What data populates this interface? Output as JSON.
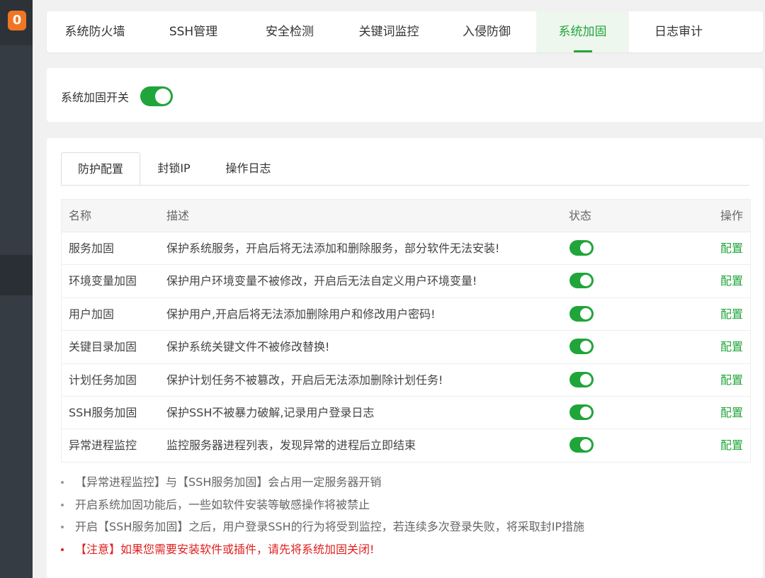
{
  "sidebar": {
    "badge": "0"
  },
  "topnav": {
    "tabs": [
      {
        "label": "系统防火墙"
      },
      {
        "label": "SSH管理"
      },
      {
        "label": "安全检测"
      },
      {
        "label": "关键词监控"
      },
      {
        "label": "入侵防御"
      },
      {
        "label": "系统加固"
      },
      {
        "label": "日志审计"
      }
    ],
    "active_index": 5
  },
  "switch_panel": {
    "label": "系统加固开关",
    "enabled": true
  },
  "subtabs": [
    {
      "label": "防护配置"
    },
    {
      "label": "封锁IP"
    },
    {
      "label": "操作日志"
    }
  ],
  "table": {
    "headers": {
      "name": "名称",
      "desc": "描述",
      "status": "状态",
      "action": "操作"
    },
    "rows": [
      {
        "name": "服务加固",
        "desc": "保护系统服务，开启后将无法添加和删除服务，部分软件无法安装!",
        "enabled": true,
        "action": "配置"
      },
      {
        "name": "环境变量加固",
        "desc": "保护用户环境变量不被修改，开启后无法自定义用户环境变量!",
        "enabled": true,
        "action": "配置"
      },
      {
        "name": "用户加固",
        "desc": "保护用户,开启后将无法添加删除用户和修改用户密码!",
        "enabled": true,
        "action": "配置"
      },
      {
        "name": "关键目录加固",
        "desc": "保护系统关键文件不被修改替换!",
        "enabled": true,
        "action": "配置"
      },
      {
        "name": "计划任务加固",
        "desc": "保护计划任务不被篡改，开启后无法添加删除计划任务!",
        "enabled": true,
        "action": "配置"
      },
      {
        "name": "SSH服务加固",
        "desc": "保护SSH不被暴力破解,记录用户登录日志",
        "enabled": true,
        "action": "配置"
      },
      {
        "name": "异常进程监控",
        "desc": "监控服务器进程列表，发现异常的进程后立即结束",
        "enabled": true,
        "action": "配置"
      }
    ]
  },
  "notes": [
    "【异常进程监控】与【SSH服务加固】会占用一定服务器开销",
    "开启系统加固功能后，一些如软件安装等敏感操作将被禁止",
    "开启【SSH服务加固】之后，用户登录SSH的行为将受到监控，若连续多次登录失败，将采取封IP措施"
  ],
  "warning": "【注意】如果您需要安装软件或插件，请先将系统加固关闭!",
  "colors": {
    "accent": "#20a53a",
    "warning": "#e02020",
    "sidebar": "#363c44",
    "badge": "#f07624"
  }
}
